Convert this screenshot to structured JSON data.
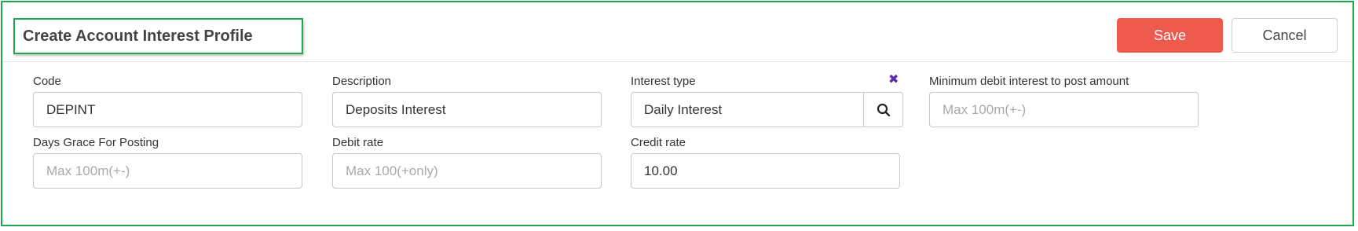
{
  "header": {
    "title": "Create Account Interest Profile",
    "save_label": "Save",
    "cancel_label": "Cancel"
  },
  "colors": {
    "accent_green": "#1ea94f",
    "save_button": "#ee5b4e",
    "clear_icon": "#5a2ca8"
  },
  "form": {
    "code": {
      "label": "Code",
      "value": "DEPINT"
    },
    "description": {
      "label": "Description",
      "value": "Deposits Interest"
    },
    "interest_type": {
      "label": "Interest type",
      "value": "Daily Interest",
      "clear_icon": "close-icon",
      "search_icon": "search-icon"
    },
    "min_debit_interest": {
      "label": "Minimum debit interest to post amount",
      "placeholder": "Max 100m(+-)"
    },
    "days_grace": {
      "label": "Days Grace For Posting",
      "placeholder": "Max 100m(+-)"
    },
    "debit_rate": {
      "label": "Debit rate",
      "placeholder": "Max 100(+only)"
    },
    "credit_rate": {
      "label": "Credit rate",
      "value": "10.00"
    }
  }
}
